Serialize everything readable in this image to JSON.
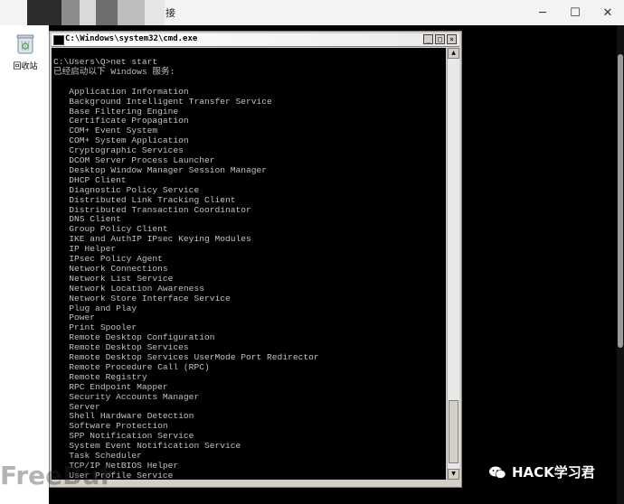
{
  "host": {
    "title_suffix": "接",
    "controls": {
      "minimize": "─",
      "maximize": "☐",
      "close": "✕"
    }
  },
  "desktop": {
    "recycle_bin_label": "回收站"
  },
  "cmd": {
    "title": "C:\\Windows\\system32\\cmd.exe",
    "controls": {
      "minimize": "_",
      "maximize": "□",
      "close": "×"
    },
    "lines": [
      "C:\\Users\\Q>net start",
      "已经启动以下 Windows 服务:",
      "",
      "   Application Information",
      "   Background Intelligent Transfer Service",
      "   Base Filtering Engine",
      "   Certificate Propagation",
      "   COM+ Event System",
      "   COM+ System Application",
      "   Cryptographic Services",
      "   DCOM Server Process Launcher",
      "   Desktop Window Manager Session Manager",
      "   DHCP Client",
      "   Diagnostic Policy Service",
      "   Distributed Link Tracking Client",
      "   Distributed Transaction Coordinator",
      "   DNS Client",
      "   Group Policy Client",
      "   IKE and AuthIP IPsec Keying Modules",
      "   IP Helper",
      "   IPsec Policy Agent",
      "   Network Connections",
      "   Network List Service",
      "   Network Location Awareness",
      "   Network Store Interface Service",
      "   Plug and Play",
      "   Power",
      "   Print Spooler",
      "   Remote Desktop Configuration",
      "   Remote Desktop Services",
      "   Remote Desktop Services UserMode Port Redirector",
      "   Remote Procedure Call (RPC)",
      "   Remote Registry",
      "   RPC Endpoint Mapper",
      "   Security Accounts Manager",
      "   Server",
      "   Shell Hardware Detection",
      "   Software Protection",
      "   SPP Notification Service",
      "   System Event Notification Service",
      "   Task Scheduler",
      "   TCP/IP NetBIOS Helper",
      "   User Profile Service"
    ]
  },
  "watermark": {
    "text": "HACK学习君",
    "left_text": "FreeBuf"
  }
}
